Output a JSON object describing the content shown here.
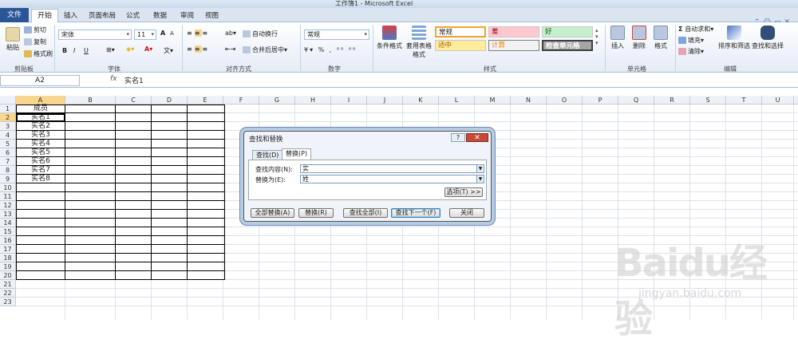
{
  "window": {
    "title": "工作簿1 - Microsoft Excel"
  },
  "tabs": [
    "开始",
    "插入",
    "页面布局",
    "公式",
    "数据",
    "审阅",
    "视图"
  ],
  "file_tab": "文件",
  "ribbon": {
    "clipboard": {
      "label": "剪贴板",
      "paste": "粘贴",
      "cut": "剪切",
      "copy": "复制",
      "format_painter": "格式刷"
    },
    "font": {
      "label": "字体",
      "name": "宋体",
      "size": "11",
      "bold": "B",
      "italic": "I",
      "underline": "U",
      "grow": "A",
      "shrink": "A"
    },
    "alignment": {
      "label": "对齐方式",
      "wrap": "自动换行",
      "merge": "合并后居中"
    },
    "number": {
      "label": "数字",
      "format": "常规"
    },
    "styles": {
      "label": "样式",
      "conditional": "条件格式",
      "table": "套用表格格式",
      "cells": [
        {
          "text": "常规"
        },
        {
          "text": "差"
        },
        {
          "text": "好"
        },
        {
          "text": "适中"
        },
        {
          "text": "计算"
        },
        {
          "text": "检查单元格"
        }
      ]
    },
    "cells": {
      "label": "单元格",
      "insert": "插入",
      "delete": "删除",
      "format": "格式"
    },
    "editing": {
      "label": "编辑",
      "autosum": "自动求和",
      "fill": "填充",
      "clear": "清除",
      "sort": "排序和筛选",
      "find": "查找和选择"
    }
  },
  "formula_bar": {
    "name_box": "A2",
    "fx": "fx",
    "value": "实名1"
  },
  "grid": {
    "columns": [
      "A",
      "B",
      "C",
      "D",
      "E",
      "F",
      "G",
      "H",
      "I",
      "J",
      "K",
      "L",
      "M",
      "N",
      "O",
      "P",
      "Q",
      "R",
      "S",
      "T",
      "U"
    ],
    "rows": [
      "1",
      "2",
      "3",
      "4",
      "5",
      "6",
      "7",
      "8",
      "9",
      "10",
      "11",
      "12",
      "13",
      "14",
      "15",
      "16",
      "17",
      "18",
      "19",
      "20",
      "21",
      "22",
      "23"
    ],
    "col_a": [
      "成员",
      "实名1",
      "实名2",
      "实名3",
      "实名4",
      "实名5",
      "实名6",
      "实名7",
      "实名8"
    ]
  },
  "dialog": {
    "title": "查找和替换",
    "help": "?",
    "close": "✕",
    "tab_find": "查找(D)",
    "tab_replace": "替换(P)",
    "find_label": "查找内容(N):",
    "find_value": "实",
    "replace_label": "替换为(E):",
    "replace_value": "姓",
    "options": "选项(T) >>",
    "btn_replace_all": "全部替换(A)",
    "btn_replace": "替换(R)",
    "btn_find_all": "查找全部(I)",
    "btn_find_next": "查找下一个(F)",
    "btn_close": "关闭"
  },
  "watermark": {
    "text": "Baidu经验",
    "url": "jingyan.baidu.com"
  }
}
